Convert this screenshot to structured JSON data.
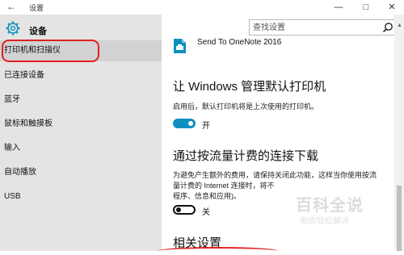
{
  "window": {
    "title": "设置",
    "back_glyph": "←",
    "min_glyph": "—",
    "max_glyph": "□",
    "close_glyph": "✕"
  },
  "sidebar": {
    "title": "设备",
    "items": [
      {
        "label": "打印机和扫描仪",
        "active": true
      },
      {
        "label": "已连接设备"
      },
      {
        "label": "蓝牙"
      },
      {
        "label": "鼠标和触摸板"
      },
      {
        "label": "输入"
      },
      {
        "label": "自动播放"
      },
      {
        "label": "USB"
      }
    ]
  },
  "search": {
    "placeholder": "查找设置"
  },
  "printer": {
    "name": "Send To OneNote 2016"
  },
  "default_printer": {
    "heading": "让 Windows 管理默认打印机",
    "description": "启用后，默认打印机将是上次使用的打印机。",
    "toggle_state": "开"
  },
  "metered": {
    "heading": "通过按流量计费的连接下载",
    "description_lines": [
      "为避免产生额外的费用，请保持关闭此功能，这样当你使用按流",
      "量计费的 Internet 连接时，将不",
      "程序、信息和应用)。"
    ],
    "toggle_state": "关"
  },
  "related": {
    "heading": "相关设置"
  },
  "watermark": {
    "title": "百科全说",
    "subtitle": "助你轻松解决"
  },
  "colors": {
    "accent": "#0f8fc0",
    "highlight": "#e02020",
    "sidebar_bg": "#e4e4e4"
  }
}
